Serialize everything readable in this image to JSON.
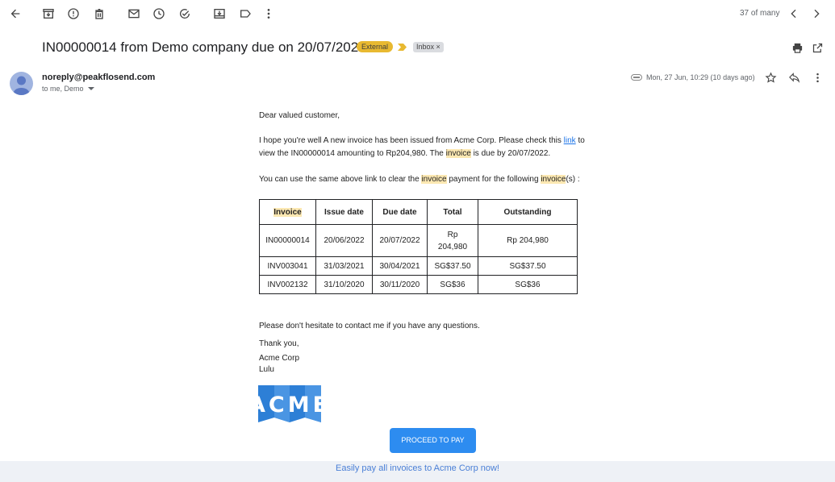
{
  "toolbar": {
    "icons": [
      "back-arrow-icon",
      "archive-icon",
      "report-spam-icon",
      "delete-icon",
      "mark-unread-icon",
      "snooze-icon",
      "add-task-icon",
      "move-to-icon",
      "label-icon",
      "more-icon"
    ],
    "pager": "37 of many"
  },
  "email": {
    "subject": "IN00000014 from Demo company due on 20/07/2022",
    "badge_external": "External",
    "badge_inbox": "Inbox",
    "inbox_close": "×",
    "sender": "noreply@peakflosend.com",
    "recipients": "to me, Demo",
    "date": "Mon, 27 Jun, 10:29 (10 days ago)"
  },
  "body": {
    "greeting": "Dear valued customer,",
    "p1_a": "I hope you're well A new invoice has been issued from Acme Corp. Please check this ",
    "p1_link": "link",
    "p1_b": " to",
    "p1_c": "view the IN00000014 amounting to Rp204,980. The ",
    "p1_hl": "invoice",
    "p1_d": " is due by 20/07/2022.",
    "p2_a": "You can use the same above link to clear the ",
    "p2_hl1": "invoice",
    "p2_b": " payment for the following ",
    "p2_hl2": "invoice",
    "p2_c": "(s) :",
    "table": {
      "headers": [
        "Invoice",
        "Issue date",
        "Due date",
        "Total",
        "Outstanding"
      ],
      "rows": [
        [
          "IN00000014",
          "20/06/2022",
          "20/07/2022",
          "Rp\n204,980",
          "Rp 204,980"
        ],
        [
          "INV003041",
          "31/03/2021",
          "30/04/2021",
          "SG$37.50",
          "SG$37.50"
        ],
        [
          "INV002132",
          "31/10/2020",
          "30/11/2020",
          "SG$36",
          "SG$36"
        ]
      ]
    },
    "closing": "Please don't hesitate to contact me if you have any questions.",
    "thanks": "Thank you,",
    "company": "Acme Corp",
    "signer": "Lulu",
    "logo_text": "ACME",
    "pay_button": "PROCEED TO PAY",
    "footer_link": "Easily pay all invoices to Acme Corp now!"
  },
  "colors": {
    "accent": "#2d8cf0",
    "highlight": "#fce8b2",
    "external_badge": "#e8b931",
    "logo_blue": "#2d7fd6"
  }
}
